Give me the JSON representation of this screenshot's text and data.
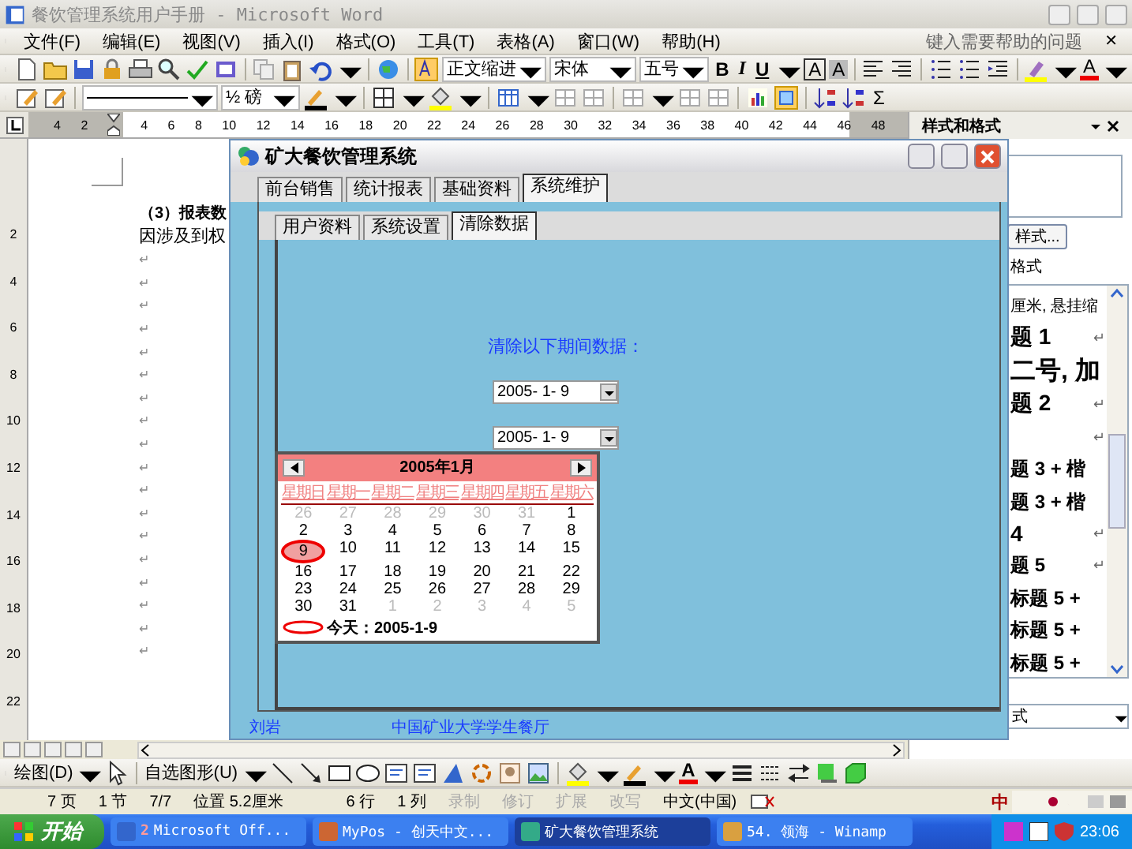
{
  "word_window": {
    "title": "餐饮管理系统用户手册 - Microsoft Word",
    "menu": [
      {
        "label": "文件(F)"
      },
      {
        "label": "编辑(E)"
      },
      {
        "label": "视图(V)"
      },
      {
        "label": "插入(I)"
      },
      {
        "label": "格式(O)"
      },
      {
        "label": "工具(T)"
      },
      {
        "label": "表格(A)"
      },
      {
        "label": "窗口(W)"
      },
      {
        "label": "帮助(H)"
      }
    ],
    "help_placeholder": "键入需要帮助的问题",
    "close_document": "✕",
    "formatting": {
      "style": "正文缩进",
      "font": "宋体",
      "size": "五号",
      "bold": "B",
      "italic": "I",
      "underline": "U",
      "char_border": "A",
      "char_shading": "A",
      "font_color": "A"
    },
    "tables_toolbar": {
      "line_weight": "½ 磅",
      "autosum": "Σ"
    },
    "ruler": {
      "labels": [
        "4",
        "2",
        "4",
        "6",
        "8",
        "10",
        "12",
        "14",
        "16",
        "18",
        "20",
        "22",
        "24",
        "26",
        "28",
        "30",
        "32",
        "34",
        "36",
        "38",
        "40",
        "42",
        "44",
        "46",
        "48"
      ]
    },
    "vertical_ruler": {
      "labels": [
        "2",
        "4",
        "6",
        "8",
        "10",
        "12",
        "14",
        "16",
        "18",
        "20",
        "22"
      ]
    },
    "document": {
      "lines": [
        {
          "kind": "heading",
          "text": "（3）报表数"
        },
        {
          "kind": "body",
          "text": "因涉及到权"
        },
        {
          "kind": "mark",
          "text": "↵"
        },
        {
          "kind": "mark",
          "text": "↵"
        },
        {
          "kind": "mark",
          "text": "↵"
        },
        {
          "kind": "mark",
          "text": "↵"
        },
        {
          "kind": "mark",
          "text": "↵"
        },
        {
          "kind": "mark",
          "text": "↵"
        },
        {
          "kind": "mark",
          "text": "↵"
        },
        {
          "kind": "mark",
          "text": "↵"
        },
        {
          "kind": "mark",
          "text": "↵"
        },
        {
          "kind": "mark",
          "text": "↵"
        },
        {
          "kind": "mark",
          "text": "↵"
        },
        {
          "kind": "mark",
          "text": "↵"
        },
        {
          "kind": "mark",
          "text": "↵"
        },
        {
          "kind": "mark",
          "text": "↵"
        },
        {
          "kind": "mark",
          "text": "↵"
        },
        {
          "kind": "mark",
          "text": "↵"
        },
        {
          "kind": "mark",
          "text": "↵"
        },
        {
          "kind": "mark",
          "text": "↵"
        }
      ]
    },
    "task_pane": {
      "title": "样式和格式",
      "style_button": "样式...",
      "label": "格式",
      "styles": [
        {
          "kind": "small",
          "text": "厘米, 悬挂缩"
        },
        {
          "kind": "heading",
          "text": "题 1",
          "mark": "↵"
        },
        {
          "kind": "huge",
          "text": "二号, 加"
        },
        {
          "kind": "heading",
          "text": "题 2",
          "mark": "↵"
        },
        {
          "kind": "small",
          "mark": "↵"
        },
        {
          "kind": "medium",
          "text": "题 3 + 楷"
        },
        {
          "kind": "medium",
          "text": "题 3 + 楷"
        },
        {
          "kind": "heading",
          "text": "4",
          "mark": "↵"
        },
        {
          "kind": "medium",
          "text": "题 5",
          "mark": "↵"
        },
        {
          "kind": "medium",
          "text": "标题 5 +"
        },
        {
          "kind": "medium",
          "text": "标题 5 +"
        },
        {
          "kind": "medium",
          "text": "标题 5 +"
        }
      ],
      "show": "式"
    },
    "drawing_toolbar": {
      "draw_menu": "绘图(D)",
      "autoshapes": "自选图形(U)",
      "font_color": "A"
    },
    "status_bar": {
      "page": "7 页",
      "section": "1 节",
      "pages": "7/7",
      "position": "位置 5.2厘米",
      "line": "6 行",
      "column": "1 列",
      "modes": [
        {
          "label": "录制",
          "active": false
        },
        {
          "label": "修订",
          "active": false
        },
        {
          "label": "扩展",
          "active": false
        },
        {
          "label": "改写",
          "active": false
        }
      ],
      "language": "中文(中国)",
      "ime": "中"
    }
  },
  "app_window": {
    "title": "矿大餐饮管理系统",
    "tabs": [
      {
        "label": "前台销售",
        "selected": false
      },
      {
        "label": "统计报表",
        "selected": false
      },
      {
        "label": "基础资料",
        "selected": false
      },
      {
        "label": "系统维护",
        "selected": true
      }
    ],
    "subtabs": [
      {
        "label": "用户资料",
        "selected": false
      },
      {
        "label": "系统设置",
        "selected": false
      },
      {
        "label": "清除数据",
        "selected": true
      }
    ],
    "prompt": "清除以下期间数据：",
    "date_fields": [
      {
        "value": "2005- 1- 9"
      },
      {
        "value": "2005- 1- 9"
      }
    ],
    "calendar": {
      "month": "2005年1月",
      "weekdays": [
        "星期日",
        "星期一",
        "星期二",
        "星期三",
        "星期四",
        "星期五",
        "星期六"
      ],
      "weeks": [
        [
          {
            "day": "26",
            "other_month": true,
            "selected": false
          },
          {
            "day": "27",
            "other_month": true,
            "selected": false
          },
          {
            "day": "28",
            "other_month": true,
            "selected": false
          },
          {
            "day": "29",
            "other_month": true,
            "selected": false
          },
          {
            "day": "30",
            "other_month": true,
            "selected": false
          },
          {
            "day": "31",
            "other_month": true,
            "selected": false
          },
          {
            "day": "1",
            "other_month": false,
            "selected": false
          }
        ],
        [
          {
            "day": "2",
            "other_month": false,
            "selected": false
          },
          {
            "day": "3",
            "other_month": false,
            "selected": false
          },
          {
            "day": "4",
            "other_month": false,
            "selected": false
          },
          {
            "day": "5",
            "other_month": false,
            "selected": false
          },
          {
            "day": "6",
            "other_month": false,
            "selected": false
          },
          {
            "day": "7",
            "other_month": false,
            "selected": false
          },
          {
            "day": "8",
            "other_month": false,
            "selected": false
          }
        ],
        [
          {
            "day": "9",
            "other_month": false,
            "selected": true
          },
          {
            "day": "10",
            "other_month": false,
            "selected": false
          },
          {
            "day": "11",
            "other_month": false,
            "selected": false
          },
          {
            "day": "12",
            "other_month": false,
            "selected": false
          },
          {
            "day": "13",
            "other_month": false,
            "selected": false
          },
          {
            "day": "14",
            "other_month": false,
            "selected": false
          },
          {
            "day": "15",
            "other_month": false,
            "selected": false
          }
        ],
        [
          {
            "day": "16",
            "other_month": false,
            "selected": false
          },
          {
            "day": "17",
            "other_month": false,
            "selected": false
          },
          {
            "day": "18",
            "other_month": false,
            "selected": false
          },
          {
            "day": "19",
            "other_month": false,
            "selected": false
          },
          {
            "day": "20",
            "other_month": false,
            "selected": false
          },
          {
            "day": "21",
            "other_month": false,
            "selected": false
          },
          {
            "day": "22",
            "other_month": false,
            "selected": false
          }
        ],
        [
          {
            "day": "23",
            "other_month": false,
            "selected": false
          },
          {
            "day": "24",
            "other_month": false,
            "selected": false
          },
          {
            "day": "25",
            "other_month": false,
            "selected": false
          },
          {
            "day": "26",
            "other_month": false,
            "selected": false
          },
          {
            "day": "27",
            "other_month": false,
            "selected": false
          },
          {
            "day": "28",
            "other_month": false,
            "selected": false
          },
          {
            "day": "29",
            "other_month": false,
            "selected": false
          }
        ],
        [
          {
            "day": "30",
            "other_month": false,
            "selected": false
          },
          {
            "day": "31",
            "other_month": false,
            "selected": false
          },
          {
            "day": "1",
            "other_month": true,
            "selected": false
          },
          {
            "day": "2",
            "other_month": true,
            "selected": false
          },
          {
            "day": "3",
            "other_month": true,
            "selected": false
          },
          {
            "day": "4",
            "other_month": true,
            "selected": false
          },
          {
            "day": "5",
            "other_month": true,
            "selected": false
          }
        ]
      ],
      "today": "今天：2005-1-9"
    },
    "footer": {
      "user": "刘岩",
      "organization": "中国矿业大学学生餐厅"
    }
  },
  "taskbar": {
    "start": "开始",
    "tasks": [
      {
        "count": "2",
        "label": "Microsoft Off...",
        "selected": false
      },
      {
        "label": "MyPos - 创天中文...",
        "selected": false
      },
      {
        "label": "矿大餐饮管理系统",
        "selected": true
      },
      {
        "label": "54. 领海 - Winamp",
        "selected": false
      }
    ],
    "clock": "23:06"
  }
}
